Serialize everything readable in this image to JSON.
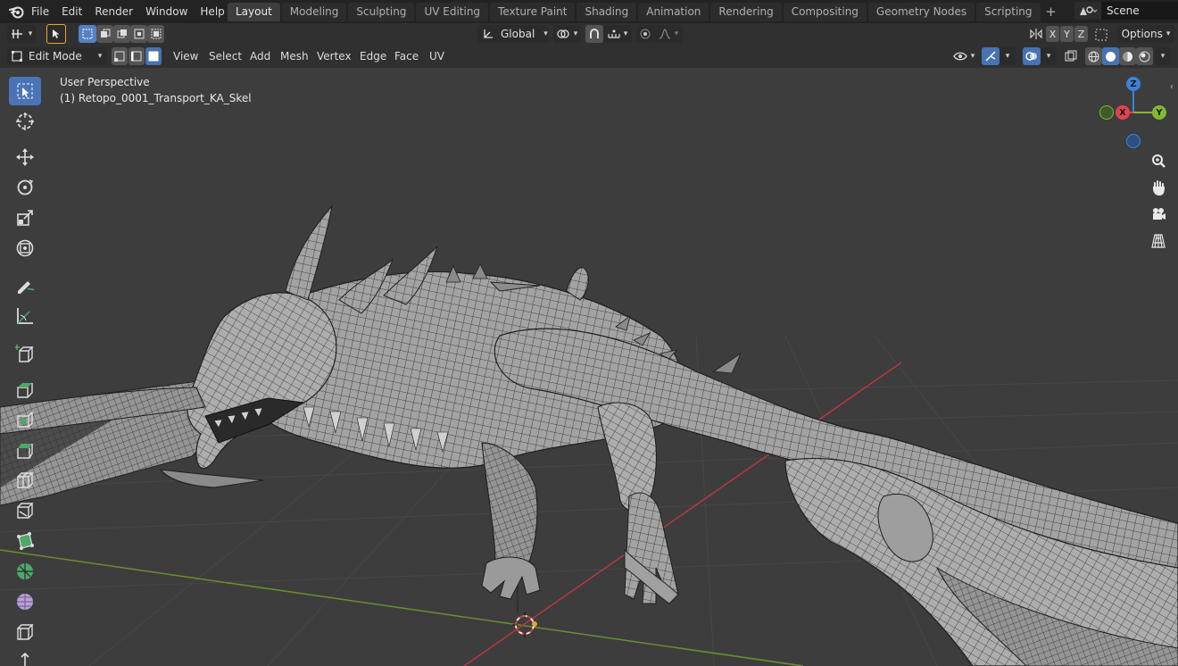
{
  "app": {
    "menu": [
      "File",
      "Edit",
      "Render",
      "Window",
      "Help"
    ],
    "workspace_tabs": [
      "Layout",
      "Modeling",
      "Sculpting",
      "UV Editing",
      "Texture Paint",
      "Shading",
      "Animation",
      "Rendering",
      "Compositing",
      "Geometry Nodes",
      "Scripting"
    ],
    "active_tab": "Layout",
    "scene_name": "Scene"
  },
  "header": {
    "transform_orientation": "Global",
    "axis_x": "X",
    "axis_y": "Y",
    "axis_z": "Z",
    "options_label": "Options"
  },
  "editor_header": {
    "mode": "Edit Mode",
    "menus": [
      "View",
      "Select",
      "Add",
      "Mesh",
      "Vertex",
      "Edge",
      "Face",
      "UV"
    ]
  },
  "viewport": {
    "perspective_label": "User Perspective",
    "object_label": "(1) Retopo_0001_Transport_KA_Skel",
    "gizmo": {
      "z": "Z",
      "x": "X",
      "y": "Y"
    }
  },
  "colors": {
    "accent_blue": "#4772b3",
    "axis_x": "#e0434f",
    "axis_y": "#84b92f",
    "axis_z": "#3b83d9",
    "viewport_bg": "#3d3d3d",
    "mesh_gray": "#9a9a9a"
  },
  "toolbar_tools": [
    "select-box",
    "cursor",
    "move",
    "rotate",
    "scale",
    "transform",
    "annotate",
    "measure",
    "add-cube",
    "extrude-region",
    "inset-faces",
    "bevel",
    "loop-cut",
    "knife",
    "poly-build",
    "spin",
    "smooth",
    "edge-slide",
    "shrink-fatten"
  ]
}
